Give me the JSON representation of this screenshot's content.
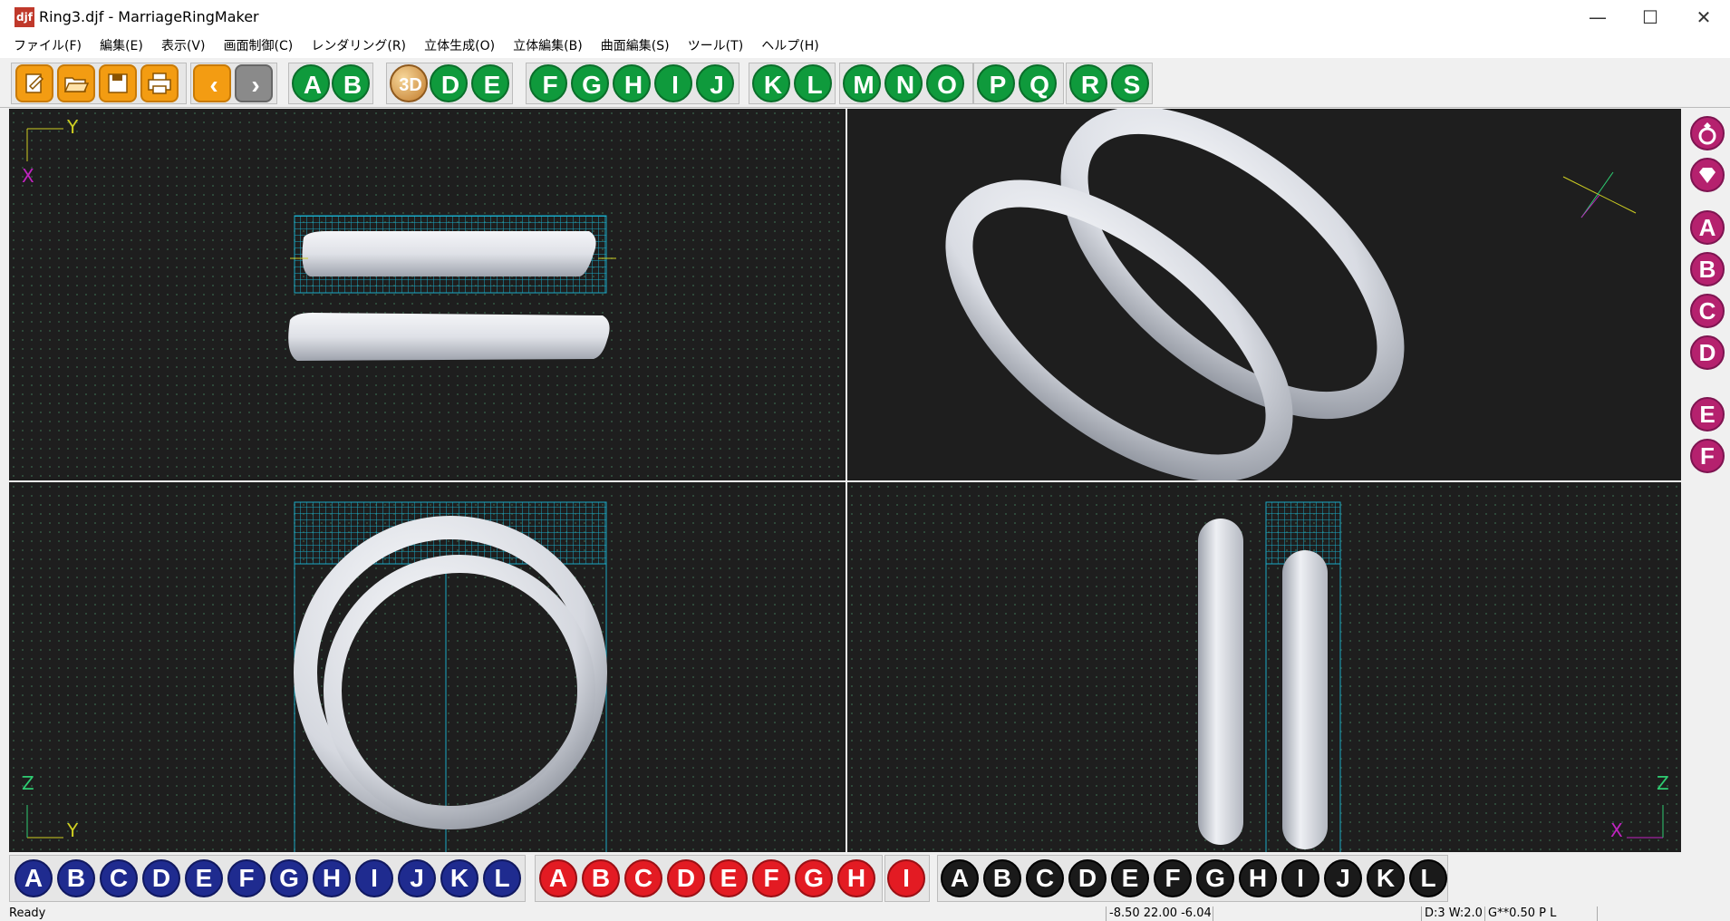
{
  "window": {
    "app_icon": "djf",
    "title": "Ring3.djf - MarriageRingMaker",
    "minimize": "—",
    "maximize": "☐",
    "close": "✕"
  },
  "menu": [
    "ファイル(F)",
    "編集(E)",
    "表示(V)",
    "画面制御(C)",
    "レンダリング(R)",
    "立体生成(O)",
    "立体編集(B)",
    "曲面編集(S)",
    "ツール(T)",
    "ヘルプ(H)"
  ],
  "toolbar": {
    "file_buttons": [
      {
        "icon": "new-file-icon"
      },
      {
        "icon": "open-folder-icon"
      },
      {
        "icon": "save-icon"
      },
      {
        "icon": "print-icon"
      }
    ],
    "nav_buttons": [
      {
        "icon": "chevron-left-icon",
        "label": "‹"
      },
      {
        "icon": "chevron-right-icon",
        "label": "›"
      }
    ],
    "letter_groups": [
      [
        "A",
        "B"
      ],
      [
        "3D",
        "D",
        "E"
      ],
      [
        "F",
        "G",
        "H",
        "I",
        "J"
      ],
      [
        "K",
        "L"
      ],
      [
        "M",
        "N",
        "O"
      ],
      [
        "P",
        "Q"
      ],
      [
        "R",
        "S"
      ]
    ]
  },
  "viewports": {
    "top_left_axes": {
      "h": "Y",
      "v": "X"
    },
    "bottom_left_axes": {
      "h": "Y",
      "v": "Z"
    },
    "bottom_right_axes": {
      "h": "X",
      "v": "Z"
    }
  },
  "side_panel": {
    "icons": [
      "ring-icon",
      "gem-icon"
    ],
    "letters": [
      "A",
      "B",
      "C",
      "D",
      "E",
      "F"
    ]
  },
  "bottom_bar": {
    "blue": [
      "A",
      "B",
      "C",
      "D",
      "E",
      "F",
      "G",
      "H",
      "I",
      "J",
      "K",
      "L"
    ],
    "red": [
      "A",
      "B",
      "C",
      "D",
      "E",
      "F",
      "G",
      "H"
    ],
    "red_single": "I",
    "black": [
      "A",
      "B",
      "C",
      "D",
      "E",
      "F",
      "G",
      "H",
      "I",
      "J",
      "K",
      "L"
    ]
  },
  "status": {
    "message": "Ready",
    "coordinates": "-8.50 22.00 -6.04",
    "display": "D:3 W:2.0",
    "grid": "G**0.50 P   L"
  },
  "colors": {
    "toolbar_green": "#0f9a3c",
    "side_magenta": "#b5216e",
    "bottom_blue": "#1f2b8f",
    "bottom_red": "#e31b23",
    "viewport_bg": "#1e1e1e"
  }
}
